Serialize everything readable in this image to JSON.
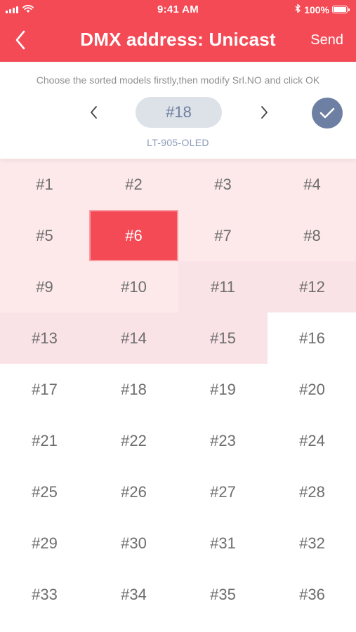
{
  "status_bar": {
    "time": "9:41 AM",
    "battery": "100%"
  },
  "nav": {
    "title": "DMX address: Unicast",
    "send_label": "Send"
  },
  "panel": {
    "instruction": "Choose the sorted models firstly,then modify Srl.NO and click OK",
    "selected_value": "#18",
    "model_name": "LT-905-OLED"
  },
  "colors": {
    "accent": "#f44a55",
    "confirm": "#6d7fa2",
    "pill_bg": "#dde1e8",
    "cell_light": "#fde9ea",
    "cell_mid": "#fae3e7"
  },
  "grid": {
    "columns": 4,
    "selected_index": 5,
    "cells": [
      {
        "label": "#1",
        "tint": "light"
      },
      {
        "label": "#2",
        "tint": "light"
      },
      {
        "label": "#3",
        "tint": "light"
      },
      {
        "label": "#4",
        "tint": "light"
      },
      {
        "label": "#5",
        "tint": "light"
      },
      {
        "label": "#6",
        "tint": "selected"
      },
      {
        "label": "#7",
        "tint": "light"
      },
      {
        "label": "#8",
        "tint": "light"
      },
      {
        "label": "#9",
        "tint": "light"
      },
      {
        "label": "#10",
        "tint": "light"
      },
      {
        "label": "#11",
        "tint": "mid"
      },
      {
        "label": "#12",
        "tint": "mid"
      },
      {
        "label": "#13",
        "tint": "mid"
      },
      {
        "label": "#14",
        "tint": "mid"
      },
      {
        "label": "#15",
        "tint": "mid"
      },
      {
        "label": "#16",
        "tint": "none"
      },
      {
        "label": "#17",
        "tint": "none"
      },
      {
        "label": "#18",
        "tint": "none"
      },
      {
        "label": "#19",
        "tint": "none"
      },
      {
        "label": "#20",
        "tint": "none"
      },
      {
        "label": "#21",
        "tint": "none"
      },
      {
        "label": "#22",
        "tint": "none"
      },
      {
        "label": "#23",
        "tint": "none"
      },
      {
        "label": "#24",
        "tint": "none"
      },
      {
        "label": "#25",
        "tint": "none"
      },
      {
        "label": "#26",
        "tint": "none"
      },
      {
        "label": "#27",
        "tint": "none"
      },
      {
        "label": "#28",
        "tint": "none"
      },
      {
        "label": "#29",
        "tint": "none"
      },
      {
        "label": "#30",
        "tint": "none"
      },
      {
        "label": "#31",
        "tint": "none"
      },
      {
        "label": "#32",
        "tint": "none"
      },
      {
        "label": "#33",
        "tint": "none"
      },
      {
        "label": "#34",
        "tint": "none"
      },
      {
        "label": "#35",
        "tint": "none"
      },
      {
        "label": "#36",
        "tint": "none"
      }
    ]
  }
}
